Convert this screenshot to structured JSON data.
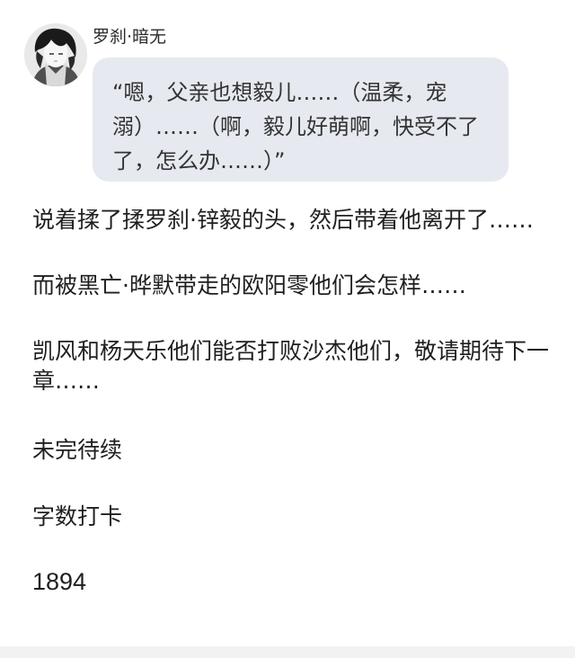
{
  "chat": {
    "sender": "罗刹·暗无",
    "avatar_icon": "anime-boy-avatar",
    "message": "“嗯，父亲也想毅儿……（温柔，宠溺）……（啊，毅儿好萌啊，快受不了了，怎么办……）”"
  },
  "story": {
    "p1": "说着揉了揉罗刹·锌毅的头，然后带着他离开了……",
    "p2": "而被黑亡·晔默带走的欧阳零他们会怎样……",
    "p3": "凯风和杨天乐他们能否打败沙杰他们，敬请期待下一章……",
    "p4": "未完待续",
    "p5": "字数打卡",
    "p6": "1894"
  },
  "colors": {
    "bubble_background": "#e6e9ef",
    "text": "#1f1f1f",
    "page_background": "#ffffff"
  }
}
